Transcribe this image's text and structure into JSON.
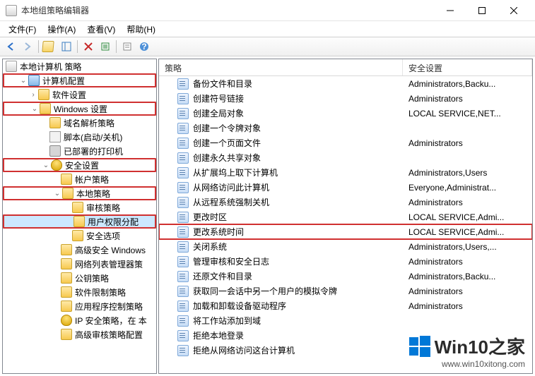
{
  "title": "本地组策略编辑器",
  "menu": {
    "file": "文件(F)",
    "action": "操作(A)",
    "view": "查看(V)",
    "help": "帮助(H)"
  },
  "toolbar_icons": [
    "back",
    "forward",
    "up",
    "show-hide-tree",
    "export-list",
    "delete",
    "refresh",
    "properties",
    "help"
  ],
  "tree": {
    "root": {
      "label": "本地计算机 策略"
    },
    "computer_config": {
      "label": "计算机配置",
      "hl": true,
      "children": [
        {
          "label": "软件设置"
        },
        {
          "label": "Windows 设置",
          "hl": true,
          "expanded": true,
          "children": [
            {
              "label": "域名解析策略"
            },
            {
              "label": "脚本(启动/关机)",
              "icon": "script"
            },
            {
              "label": "已部署的打印机",
              "icon": "printer"
            },
            {
              "label": "安全设置",
              "hl": true,
              "icon": "shield",
              "expanded": true,
              "children": [
                {
                  "label": "帐户策略"
                },
                {
                  "label": "本地策略",
                  "hl": true,
                  "expanded": true,
                  "children": [
                    {
                      "label": "审核策略"
                    },
                    {
                      "label": "用户权限分配",
                      "hl": true,
                      "selected": true
                    },
                    {
                      "label": "安全选项"
                    }
                  ]
                },
                {
                  "label": "高级安全 Windows"
                },
                {
                  "label": "网络列表管理器策"
                },
                {
                  "label": "公钥策略"
                },
                {
                  "label": "软件限制策略"
                },
                {
                  "label": "应用程序控制策略"
                },
                {
                  "label": "IP 安全策略，在 本",
                  "icon": "shield"
                },
                {
                  "label": "高级审核策略配置"
                }
              ]
            }
          ]
        }
      ]
    }
  },
  "columns": {
    "name": "策略",
    "security": "安全设置"
  },
  "list": [
    {
      "name": "备份文件和目录",
      "sec": "Administrators,Backu..."
    },
    {
      "name": "创建符号链接",
      "sec": "Administrators"
    },
    {
      "name": "创建全局对象",
      "sec": "LOCAL SERVICE,NET..."
    },
    {
      "name": "创建一个令牌对象",
      "sec": ""
    },
    {
      "name": "创建一个页面文件",
      "sec": "Administrators"
    },
    {
      "name": "创建永久共享对象",
      "sec": ""
    },
    {
      "name": "从扩展坞上取下计算机",
      "sec": "Administrators,Users"
    },
    {
      "name": "从网络访问此计算机",
      "sec": "Everyone,Administrat..."
    },
    {
      "name": "从远程系统强制关机",
      "sec": "Administrators"
    },
    {
      "name": "更改时区",
      "sec": "LOCAL SERVICE,Admi..."
    },
    {
      "name": "更改系统时间",
      "sec": "LOCAL SERVICE,Admi...",
      "hl": true
    },
    {
      "name": "关闭系统",
      "sec": "Administrators,Users,..."
    },
    {
      "name": "管理审核和安全日志",
      "sec": "Administrators"
    },
    {
      "name": "还原文件和目录",
      "sec": "Administrators,Backu..."
    },
    {
      "name": "获取同一会话中另一个用户的模拟令牌",
      "sec": "Administrators"
    },
    {
      "name": "加载和卸载设备驱动程序",
      "sec": "Administrators"
    },
    {
      "name": "将工作站添加到域",
      "sec": ""
    },
    {
      "name": "拒绝本地登录",
      "sec": ""
    },
    {
      "name": "拒绝从网络访问这台计算机",
      "sec": ""
    }
  ],
  "watermark": {
    "brand": "Win10之家",
    "url": "www.win10xitong.com"
  }
}
